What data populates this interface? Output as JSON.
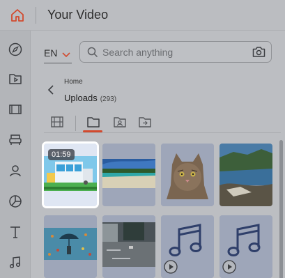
{
  "header": {
    "title": "Your Video"
  },
  "sidebar": {
    "items": [
      {
        "name": "compass-icon"
      },
      {
        "name": "media-folder-icon"
      },
      {
        "name": "film-icon"
      },
      {
        "name": "armchair-icon"
      },
      {
        "name": "person-icon"
      },
      {
        "name": "pie-chart-icon"
      },
      {
        "name": "text-icon"
      },
      {
        "name": "music-icon"
      }
    ]
  },
  "language": {
    "selected": "EN"
  },
  "search": {
    "placeholder": "Search anything"
  },
  "breadcrumb": {
    "parent": "Home"
  },
  "folder": {
    "name": "Uploads",
    "count": "(293)"
  },
  "tabs": [
    {
      "name": "film-strip-tab",
      "active": false
    },
    {
      "name": "folder-tab",
      "active": true
    },
    {
      "name": "user-folder-tab",
      "active": false
    },
    {
      "name": "shared-folder-tab",
      "active": false
    }
  ],
  "media": [
    {
      "kind": "video",
      "duration": "01:59",
      "selected": true,
      "subject": "building-illustration"
    },
    {
      "kind": "image",
      "subject": "beach"
    },
    {
      "kind": "image",
      "subject": "cat"
    },
    {
      "kind": "image",
      "subject": "coastline"
    },
    {
      "kind": "image",
      "subject": "umbrella-illustration"
    },
    {
      "kind": "image",
      "subject": "parking-lot"
    },
    {
      "kind": "audio",
      "subject": "music-note"
    },
    {
      "kind": "audio",
      "subject": "music-note"
    }
  ],
  "colors": {
    "accent": "#d24a2e",
    "selection": "#ffffff",
    "overlay": "#b7b9bd"
  }
}
